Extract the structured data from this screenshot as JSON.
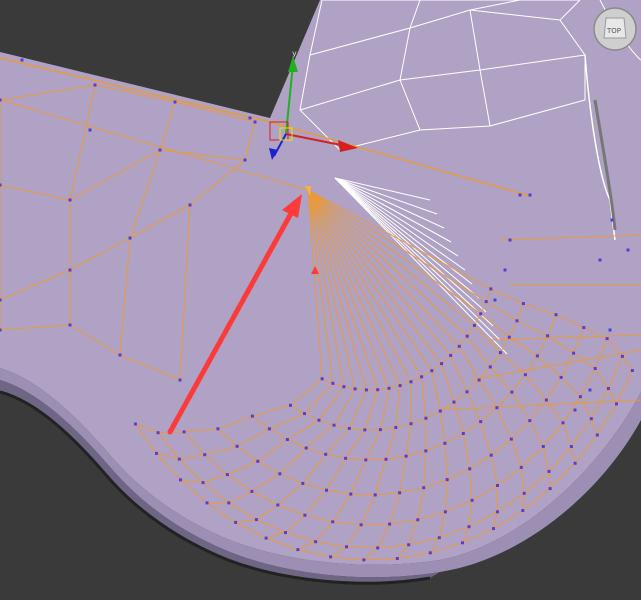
{
  "viewport": {
    "background": "#3a3a3a",
    "mesh_face_color": "#b0a2c5",
    "selected_edge_color": "#e89a3c",
    "unselected_edge_color": "#ffffff",
    "vertex_color": "#5a3cd2",
    "rim_color": "#c8b8d8"
  },
  "gizmo": {
    "x_axis_color": "#d42020",
    "y_axis_color": "#20b020",
    "z_axis_color": "#2020d0",
    "plane_color": "#e6e600"
  },
  "arrow_overlay": {
    "color": "#ff3a3a"
  },
  "viewcube": {
    "label": "TOP"
  }
}
